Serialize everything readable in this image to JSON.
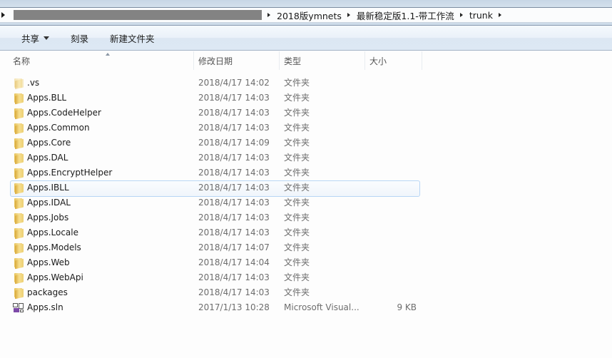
{
  "address_bar": {
    "redacted": true,
    "crumbs": [
      "2018版ymnets",
      "最新稳定版1.1-带工作流",
      "trunk"
    ]
  },
  "toolbar": {
    "share_label": "共享",
    "burn_label": "刻录",
    "new_folder_label": "新建文件夹"
  },
  "columns": {
    "name": "名称",
    "date": "修改日期",
    "type": "类型",
    "size": "大小"
  },
  "files": [
    {
      "name": ".vs",
      "date": "2018/4/17 14:02",
      "type": "文件夹",
      "size": "",
      "icon": "folder-hidden-icon"
    },
    {
      "name": "Apps.BLL",
      "date": "2018/4/17 14:03",
      "type": "文件夹",
      "size": "",
      "icon": "folder-icon"
    },
    {
      "name": "Apps.CodeHelper",
      "date": "2018/4/17 14:03",
      "type": "文件夹",
      "size": "",
      "icon": "folder-icon"
    },
    {
      "name": "Apps.Common",
      "date": "2018/4/17 14:03",
      "type": "文件夹",
      "size": "",
      "icon": "folder-icon"
    },
    {
      "name": "Apps.Core",
      "date": "2018/4/17 14:09",
      "type": "文件夹",
      "size": "",
      "icon": "folder-icon"
    },
    {
      "name": "Apps.DAL",
      "date": "2018/4/17 14:03",
      "type": "文件夹",
      "size": "",
      "icon": "folder-icon"
    },
    {
      "name": "Apps.EncryptHelper",
      "date": "2018/4/17 14:03",
      "type": "文件夹",
      "size": "",
      "icon": "folder-icon"
    },
    {
      "name": "Apps.IBLL",
      "date": "2018/4/17 14:03",
      "type": "文件夹",
      "size": "",
      "icon": "folder-icon",
      "hovered": true
    },
    {
      "name": "Apps.IDAL",
      "date": "2018/4/17 14:03",
      "type": "文件夹",
      "size": "",
      "icon": "folder-icon"
    },
    {
      "name": "Apps.Jobs",
      "date": "2018/4/17 14:03",
      "type": "文件夹",
      "size": "",
      "icon": "folder-icon"
    },
    {
      "name": "Apps.Locale",
      "date": "2018/4/17 14:03",
      "type": "文件夹",
      "size": "",
      "icon": "folder-icon"
    },
    {
      "name": "Apps.Models",
      "date": "2018/4/17 14:07",
      "type": "文件夹",
      "size": "",
      "icon": "folder-icon"
    },
    {
      "name": "Apps.Web",
      "date": "2018/4/17 14:04",
      "type": "文件夹",
      "size": "",
      "icon": "folder-icon"
    },
    {
      "name": "Apps.WebApi",
      "date": "2018/4/17 14:03",
      "type": "文件夹",
      "size": "",
      "icon": "folder-icon"
    },
    {
      "name": "packages",
      "date": "2018/4/17 14:03",
      "type": "文件夹",
      "size": "",
      "icon": "folder-icon"
    },
    {
      "name": "Apps.sln",
      "date": "2017/1/13 10:28",
      "type": "Microsoft Visual...",
      "size": "9 KB",
      "icon": "vs-solution-icon"
    }
  ]
}
